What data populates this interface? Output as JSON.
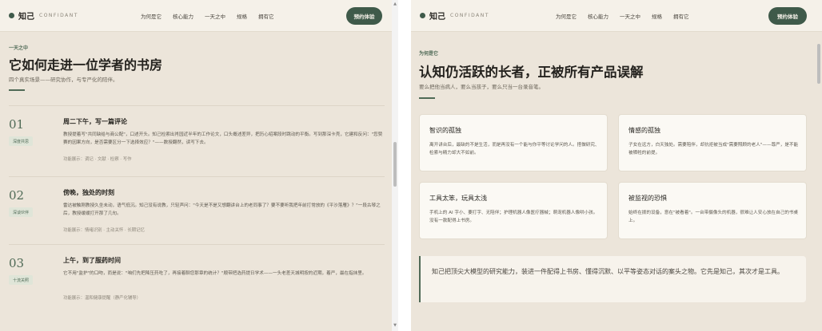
{
  "left": {
    "nav": {
      "brand_cn": "知己",
      "brand_en": "CONFIDANT",
      "links": [
        "为何是它",
        "核心能力",
        "一天之中",
        "规格",
        "拥有它"
      ],
      "cta": "预约体验"
    },
    "section": {
      "eyebrow": "一天之中",
      "title": "它如何走进一位学者的书房",
      "subtitle": "四个真实场景——研究协作，与专严化的陪伴。"
    },
    "rows": [
      {
        "num": "01",
        "tag": "深度共思",
        "title": "周二下午，写一篇评论",
        "body": "教授提着写\"共同缺给与商公配\"，口述开头。知己检索出肖园近半年的工作论文，口头概述差异，把历心绍案段时跳动的平衡。写到那深卡壳，它建和反问：\"您赞赛的因果方向，是否需要区分一下选择效应？\"——数授翻然，读写下去。",
        "meta": "功能展示：调记 · 文献 · 检察 · 写作"
      },
      {
        "num": "02",
        "tag": "深谈伙伴",
        "title": "傍晚，独处的时刻",
        "body": "雷达被触刚教授久坐未动，语气低沉。知己没有说教，只轻声问：\"今天是不是又想翻讲台上的老同事了？要不要听我把年前打常放的《平沙落雁》？\"一段古琴之后，教授缓缓打开那了几句。",
        "meta": "功能展示：情绪识别 · 主动关怀 · 长期记忆"
      },
      {
        "num": "03",
        "tag": "十流关照",
        "title": "上午，到了服药时间",
        "body": "它不用\"监护\"的口吻，而是说：\"咱们先把降压药吃了，再接着聊您那章的统计？\"顺带把选药提日学术——一头老差天城明按的近期，着严，最在指抹里。",
        "meta": "功能展示：温和健康提醒（静产化辅导）"
      }
    ]
  },
  "right": {
    "nav": {
      "brand_cn": "知己",
      "brand_en": "CONFIDANT",
      "links": [
        "为何是它",
        "核心能力",
        "一天之中",
        "规格",
        "拥有它"
      ],
      "cta": "预约体验"
    },
    "section": {
      "eyebrow": "为何是它",
      "title": "认知仍活跃的长者，正被所有产品误解",
      "subtitle": "要么把他当病人，要么当孩子，要么只当一台录音笔。"
    },
    "cards": [
      {
        "title": "智识的孤独",
        "body": "离开讲台后，最缺的不是生活，而是再没有一个能与你平等讨论学问的人。搭做研究、检索与精力却大不如前。"
      },
      {
        "title": "情感的孤独",
        "body": "子女在远方，白天独处。需要陪伴，却抗拒被当成\"需要照顾的老人\"——尊严，是不能被牺牲的前提。"
      },
      {
        "title": "工具太笨，玩具太浅",
        "body": "手机上的 AI 字小、要打字、无陪伴；护理机器人像医疗器械；萌宠机器人像哄小孩。没有一款配得上书房。"
      },
      {
        "title": "被监视的恐惧",
        "body": "始终在拨的设备，意在\"被看着\"。一台带摄像头的机器，很难让人安心放在自己的书桌上。"
      }
    ],
    "quote": "知己把顶尖大模型的研究能力，装进一件配得上书房、懂得沉默、以平等姿态对话的案头之物。它先是知己，其次才是工具。"
  }
}
